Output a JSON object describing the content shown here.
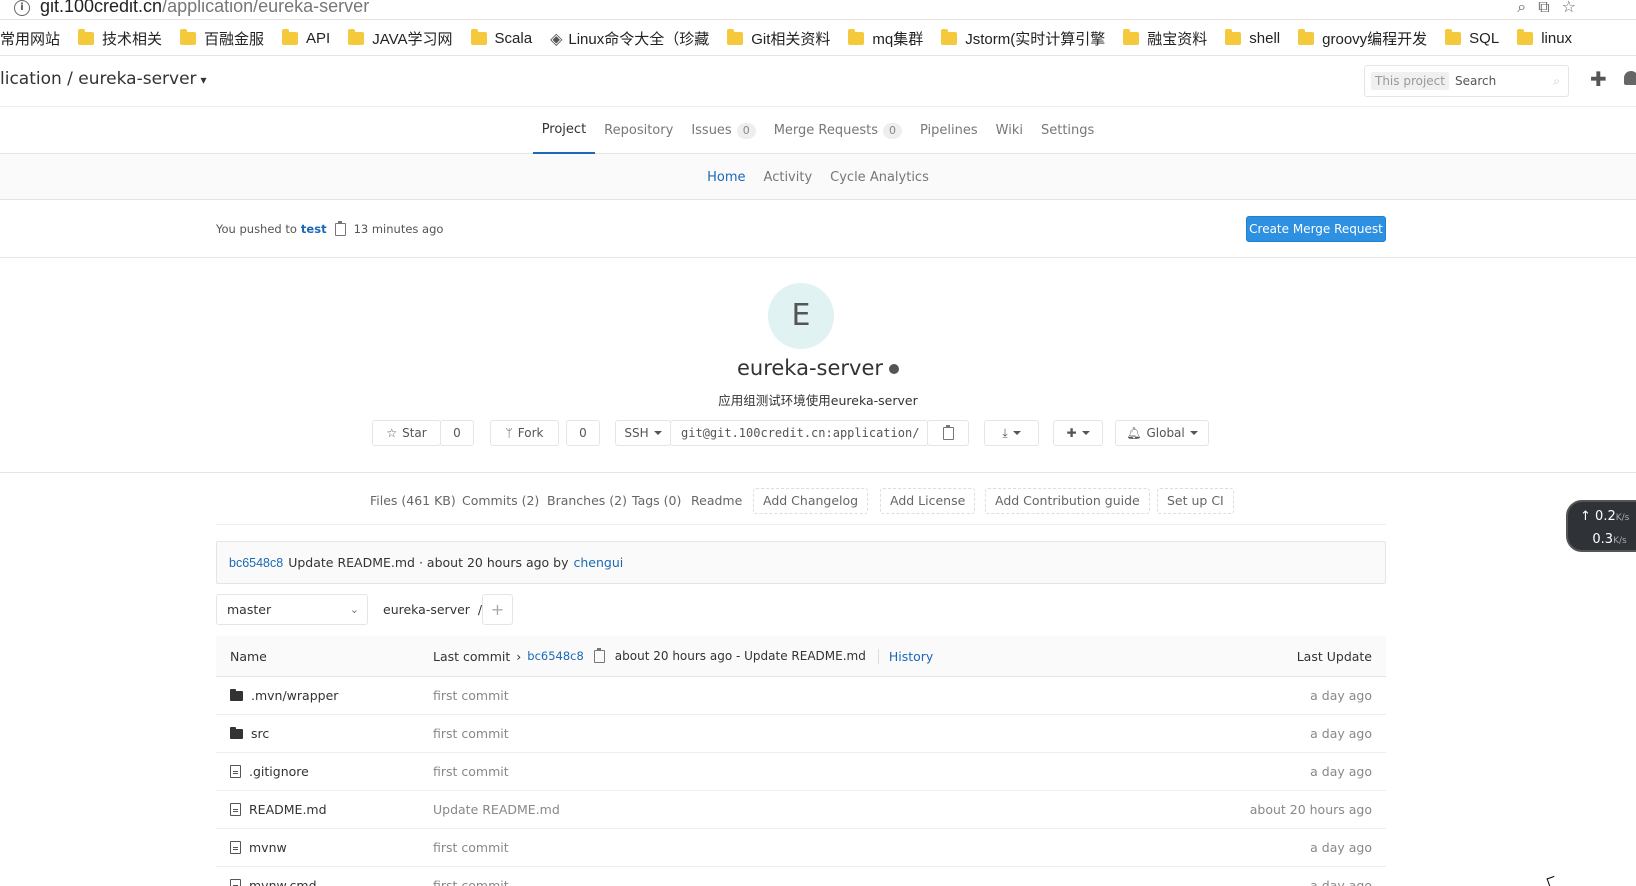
{
  "browser": {
    "url_host": "git.100credit.cn",
    "url_path": "/application/eureka-server",
    "bookmarks": [
      {
        "label": "常用网站",
        "icon": "none"
      },
      {
        "label": "技术相关",
        "icon": "folder"
      },
      {
        "label": "百融金服",
        "icon": "folder"
      },
      {
        "label": "API",
        "icon": "folder"
      },
      {
        "label": "JAVA学习网",
        "icon": "folder"
      },
      {
        "label": "Scala",
        "icon": "folder"
      },
      {
        "label": "Linux命令大全（珍藏",
        "icon": "page"
      },
      {
        "label": "Git相关资料",
        "icon": "folder"
      },
      {
        "label": "mq集群",
        "icon": "folder"
      },
      {
        "label": "Jstorm(实时计算引擎",
        "icon": "folder"
      },
      {
        "label": "融宝资料",
        "icon": "folder"
      },
      {
        "label": "shell",
        "icon": "folder"
      },
      {
        "label": "groovy编程开发",
        "icon": "folder"
      },
      {
        "label": "SQL",
        "icon": "folder"
      },
      {
        "label": "linux",
        "icon": "folder"
      }
    ]
  },
  "header": {
    "breadcrumb": "lication / eureka-server",
    "search_scope": "This project",
    "search_placeholder": "Search"
  },
  "nav": {
    "tabs": [
      {
        "label": "Project",
        "active": true
      },
      {
        "label": "Repository"
      },
      {
        "label": "Issues",
        "badge": "0"
      },
      {
        "label": "Merge Requests",
        "badge": "0"
      },
      {
        "label": "Pipelines"
      },
      {
        "label": "Wiki"
      },
      {
        "label": "Settings"
      }
    ],
    "subtabs": [
      {
        "label": "Home",
        "active": true
      },
      {
        "label": "Activity"
      },
      {
        "label": "Cycle Analytics"
      }
    ]
  },
  "push": {
    "prefix": "You pushed to",
    "branch": "test",
    "time": "13 minutes ago",
    "button": "Create Merge Request"
  },
  "project": {
    "avatar_letter": "E",
    "name": "eureka-server",
    "description": "应用组测试环境使用eureka-server",
    "star_label": "Star",
    "star_count": "0",
    "fork_label": "Fork",
    "fork_count": "0",
    "protocol": "SSH",
    "clone_url": "git@git.100credit.cn:application/",
    "notification": "Global"
  },
  "stats": {
    "files": "Files (461 KB)",
    "commits": "Commits (2)",
    "branches": "Branches (2)",
    "tags": "Tags (0)",
    "readme": "Readme",
    "add_changelog": "Add Changelog",
    "add_license": "Add License",
    "add_contribution": "Add Contribution guide",
    "setup_ci": "Set up CI"
  },
  "last_commit": {
    "sha": "bc6548c8",
    "message": "Update README.md · about 20 hours ago by",
    "author": "chengui"
  },
  "tree": {
    "branch": "master",
    "path": "eureka-server",
    "sep": "/"
  },
  "files": {
    "header": {
      "name": "Name",
      "last_commit": "Last commit",
      "sha": "bc6548c8",
      "summary": "about 20 hours ago - Update README.md",
      "history": "History",
      "last_update": "Last Update"
    },
    "rows": [
      {
        "name": ".mvn/wrapper",
        "type": "folder",
        "message": "first commit",
        "updated": "a day ago"
      },
      {
        "name": "src",
        "type": "folder",
        "message": "first commit",
        "updated": "a day ago"
      },
      {
        "name": ".gitignore",
        "type": "file",
        "message": "first commit",
        "updated": "a day ago"
      },
      {
        "name": "README.md",
        "type": "file",
        "message": "Update README.md",
        "updated": "about 20 hours ago"
      },
      {
        "name": "mvnw",
        "type": "file",
        "message": "first commit",
        "updated": "a day ago"
      },
      {
        "name": "mvnw.cmd",
        "type": "file",
        "message": "first commit",
        "updated": "a day ago"
      }
    ]
  },
  "speed": {
    "up": "0.2",
    "down": "0.3",
    "unit": "K/s"
  }
}
